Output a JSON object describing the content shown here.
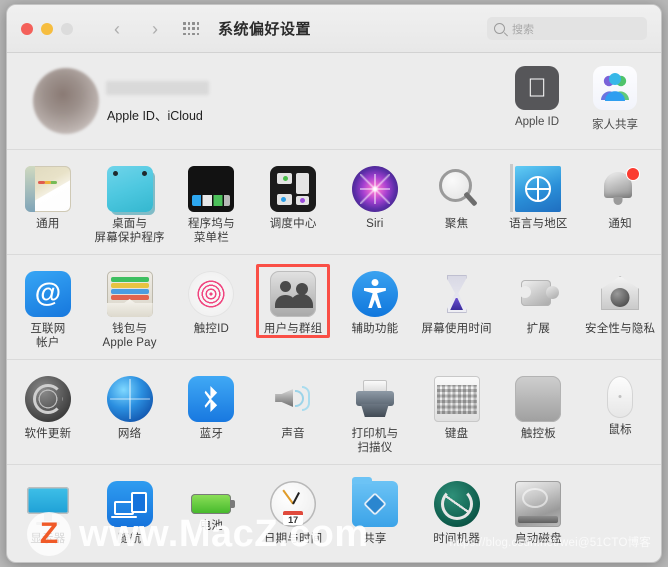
{
  "window": {
    "title": "系统偏好设置",
    "traffic_lights": [
      "close",
      "minimize",
      "zoom"
    ],
    "back_glyph": "‹",
    "forward_glyph": "›"
  },
  "search": {
    "placeholder": "搜索",
    "value": ""
  },
  "account": {
    "name_redacted": "",
    "subtitle": "Apple ID、iCloud",
    "tiles": [
      {
        "label": "Apple ID",
        "icon": "apple-logo-icon"
      },
      {
        "label": "家人共享",
        "icon": "family-sharing-icon"
      }
    ]
  },
  "sections": [
    {
      "name": "personal",
      "items": [
        {
          "label": "通用",
          "icon": "general-icon",
          "highlighted": false
        },
        {
          "label": "桌面与\n屏幕保护程序",
          "icon": "desktop-screensaver-icon",
          "highlighted": false
        },
        {
          "label": "程序坞与\n菜单栏",
          "icon": "dock-menubar-icon",
          "highlighted": false
        },
        {
          "label": "调度中心",
          "icon": "mission-control-icon",
          "highlighted": false
        },
        {
          "label": "Siri",
          "icon": "siri-icon",
          "highlighted": false
        },
        {
          "label": "聚焦",
          "icon": "spotlight-icon",
          "highlighted": false
        },
        {
          "label": "语言与地区",
          "icon": "language-region-icon",
          "highlighted": false
        },
        {
          "label": "通知",
          "icon": "notifications-icon",
          "highlighted": false
        }
      ]
    },
    {
      "name": "accounts-security",
      "items": [
        {
          "label": "互联网\n帐户",
          "icon": "internet-accounts-icon",
          "highlighted": false
        },
        {
          "label": "钱包与\nApple Pay",
          "icon": "wallet-applepay-icon",
          "highlighted": false
        },
        {
          "label": "触控ID",
          "icon": "touch-id-icon",
          "highlighted": false
        },
        {
          "label": "用户与群组",
          "icon": "users-groups-icon",
          "highlighted": true
        },
        {
          "label": "辅助功能",
          "icon": "accessibility-icon",
          "highlighted": false
        },
        {
          "label": "屏幕使用时间",
          "icon": "screen-time-icon",
          "highlighted": false
        },
        {
          "label": "扩展",
          "icon": "extensions-icon",
          "highlighted": false
        },
        {
          "label": "安全性与隐私",
          "icon": "security-privacy-icon",
          "highlighted": false
        }
      ]
    },
    {
      "name": "hardware",
      "items": [
        {
          "label": "软件更新",
          "icon": "software-update-icon",
          "highlighted": false
        },
        {
          "label": "网络",
          "icon": "network-icon",
          "highlighted": false
        },
        {
          "label": "蓝牙",
          "icon": "bluetooth-icon",
          "highlighted": false
        },
        {
          "label": "声音",
          "icon": "sound-icon",
          "highlighted": false
        },
        {
          "label": "打印机与\n扫描仪",
          "icon": "printers-scanners-icon",
          "highlighted": false
        },
        {
          "label": "键盘",
          "icon": "keyboard-icon",
          "highlighted": false
        },
        {
          "label": "触控板",
          "icon": "trackpad-icon",
          "highlighted": false
        },
        {
          "label": "鼠标",
          "icon": "mouse-icon",
          "highlighted": false
        }
      ]
    },
    {
      "name": "system",
      "items": [
        {
          "label": "显示器",
          "icon": "displays-icon",
          "highlighted": false
        },
        {
          "label": "随航",
          "icon": "sidecar-icon",
          "highlighted": false
        },
        {
          "label": "电池",
          "icon": "battery-icon",
          "highlighted": false
        },
        {
          "label": "日期与时间",
          "icon": "date-time-icon",
          "highlighted": false,
          "day_number": "17"
        },
        {
          "label": "共享",
          "icon": "sharing-icon",
          "highlighted": false
        },
        {
          "label": "时间机器",
          "icon": "time-machine-icon",
          "highlighted": false
        },
        {
          "label": "启动磁盘",
          "icon": "startup-disk-icon",
          "highlighted": false
        },
        {
          "label": "",
          "icon": "",
          "highlighted": false
        }
      ]
    }
  ],
  "watermark": {
    "logo_letter": "Z",
    "site": "www.MacZ.com",
    "url": "https://blog.csdn.net/wei@51CTO博客"
  },
  "colors": {
    "highlight": "#fa4f46",
    "window_bg": "#ececec",
    "titlebar_bg": "#f0f0f0",
    "accent_blue": "#1677dd"
  }
}
